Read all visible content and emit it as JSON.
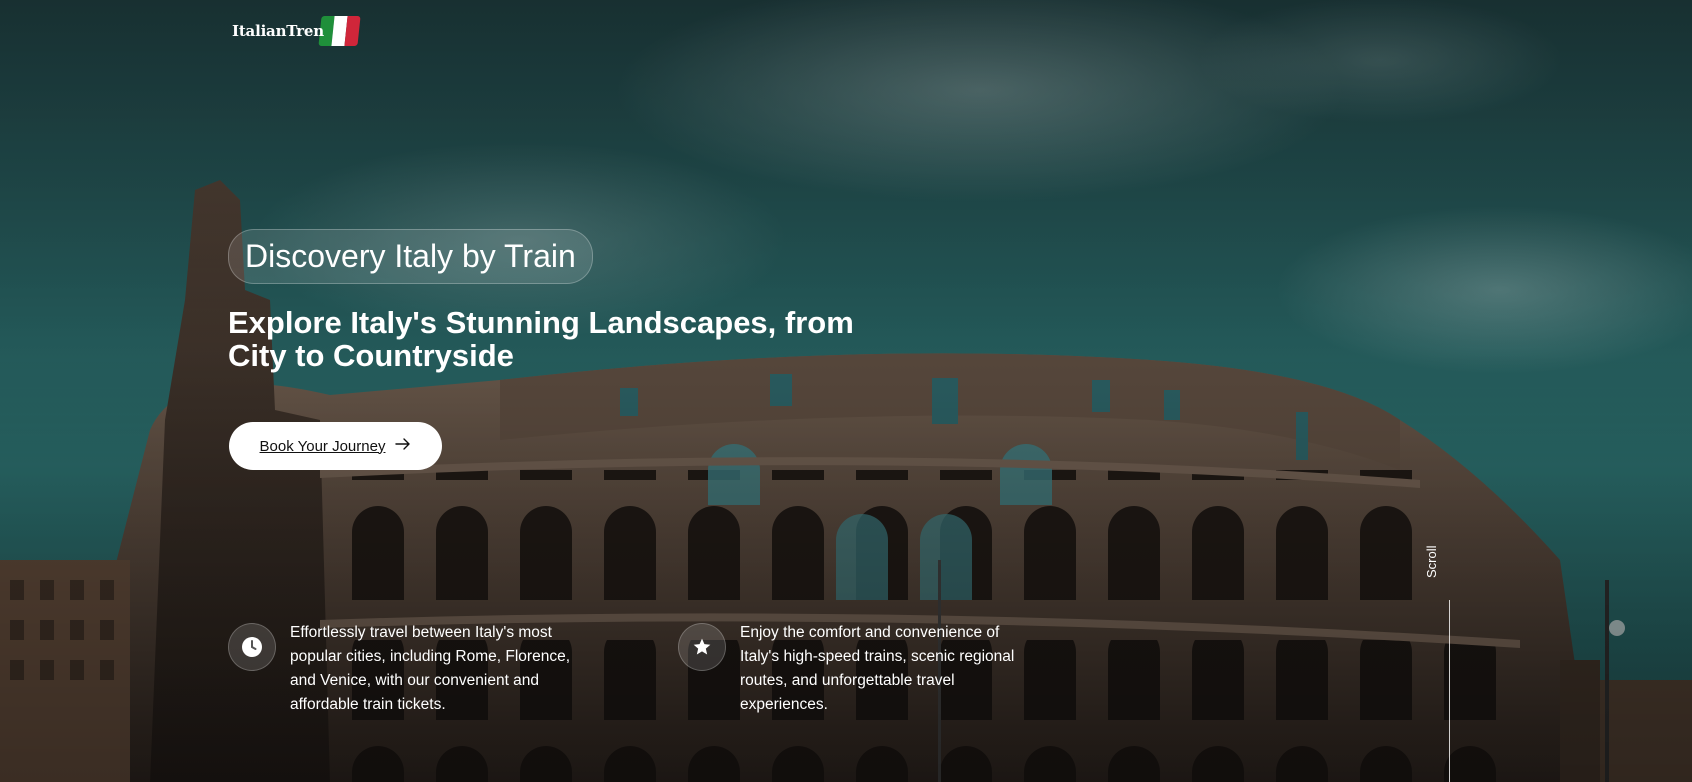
{
  "logo": {
    "text": "ItalianTren",
    "flag_colors": [
      "#1f8f3a",
      "#ffffff",
      "#d0263a"
    ]
  },
  "hero": {
    "badge_title": "Discovery Italy by Train",
    "headline": "Explore Italy's Stunning Landscapes, from City to Countryside",
    "cta_label": "Book Your Journey",
    "cta_icon": "arrow-right-icon"
  },
  "features": [
    {
      "icon": "clock-icon",
      "text": "Effortlessly travel between Italy's most popular cities, including Rome, Florence, and Venice, with our convenient and affordable train tickets."
    },
    {
      "icon": "star-icon",
      "text": "Enjoy the comfort and convenience of Italy's high-speed trains, scenic regional routes, and unforgettable travel experiences."
    }
  ],
  "scroll": {
    "label": "Scroll"
  }
}
